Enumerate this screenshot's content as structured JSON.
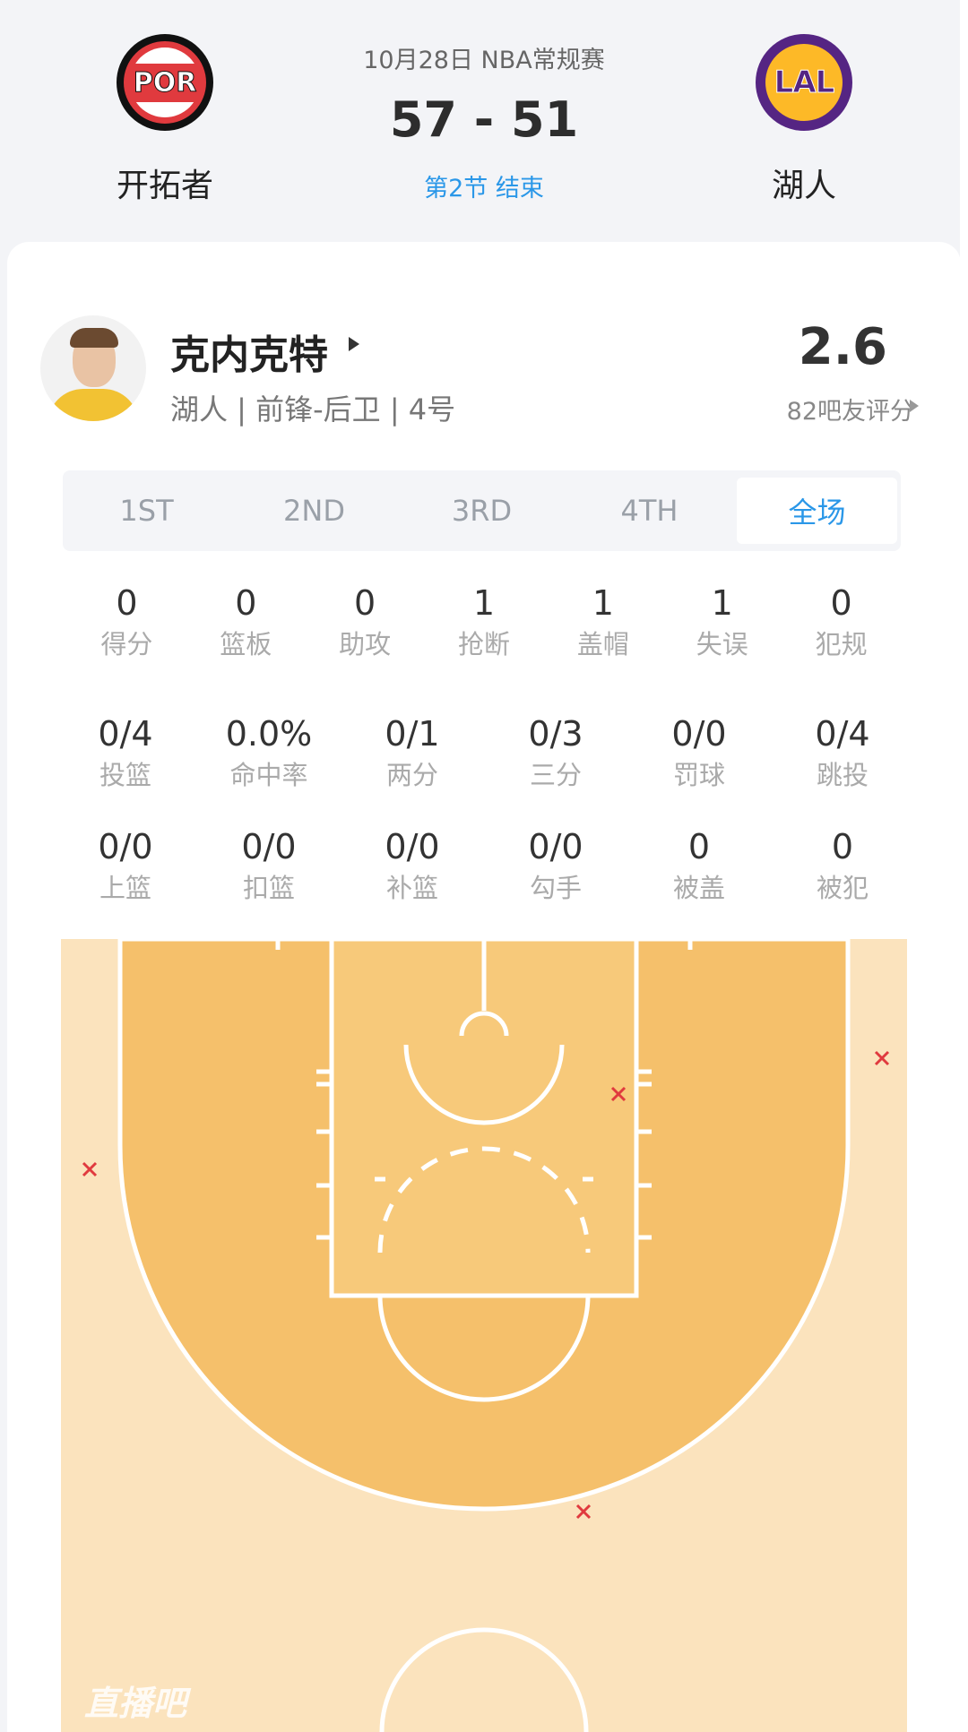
{
  "match": {
    "date": "10月28日 NBA常规赛",
    "score": "57 - 51",
    "status": "第2节 结束",
    "home_team": {
      "name": "开拓者",
      "abbr": "POR",
      "color": "#e03a3e"
    },
    "away_team": {
      "name": "湖人",
      "abbr": "LAL",
      "color": "#552583"
    }
  },
  "player": {
    "name": "克内克特",
    "meta": "湖人 | 前锋-后卫 | 4号",
    "rating": "2.6",
    "rating_label": "82吧友评分"
  },
  "tabs": [
    {
      "label": "1ST",
      "active": false
    },
    {
      "label": "2ND",
      "active": false
    },
    {
      "label": "3RD",
      "active": false
    },
    {
      "label": "4TH",
      "active": false
    },
    {
      "label": "全场",
      "active": true
    }
  ],
  "stats": {
    "row1": [
      {
        "value": "0",
        "label": "得分"
      },
      {
        "value": "0",
        "label": "篮板"
      },
      {
        "value": "0",
        "label": "助攻"
      },
      {
        "value": "1",
        "label": "抢断"
      },
      {
        "value": "1",
        "label": "盖帽"
      },
      {
        "value": "1",
        "label": "失误"
      },
      {
        "value": "0",
        "label": "犯规"
      }
    ],
    "row2": [
      {
        "value": "0/4",
        "label": "投篮"
      },
      {
        "value": "0.0%",
        "label": "命中率"
      },
      {
        "value": "0/1",
        "label": "两分"
      },
      {
        "value": "0/3",
        "label": "三分"
      },
      {
        "value": "0/0",
        "label": "罚球"
      },
      {
        "value": "0/4",
        "label": "跳投"
      }
    ],
    "row3": [
      {
        "value": "0/0",
        "label": "上篮"
      },
      {
        "value": "0/0",
        "label": "扣篮"
      },
      {
        "value": "0/0",
        "label": "补篮"
      },
      {
        "value": "0/0",
        "label": "勾手"
      },
      {
        "value": "0",
        "label": "被盖"
      },
      {
        "value": "0",
        "label": "被犯"
      }
    ]
  },
  "shot_chart": {
    "missed_shots": 4,
    "miss_marker": "×",
    "miss_color": "#e03a3e",
    "court_color": "#f5c06b",
    "court_bg_color": "#fbe3bd"
  },
  "watermark": "直播吧"
}
